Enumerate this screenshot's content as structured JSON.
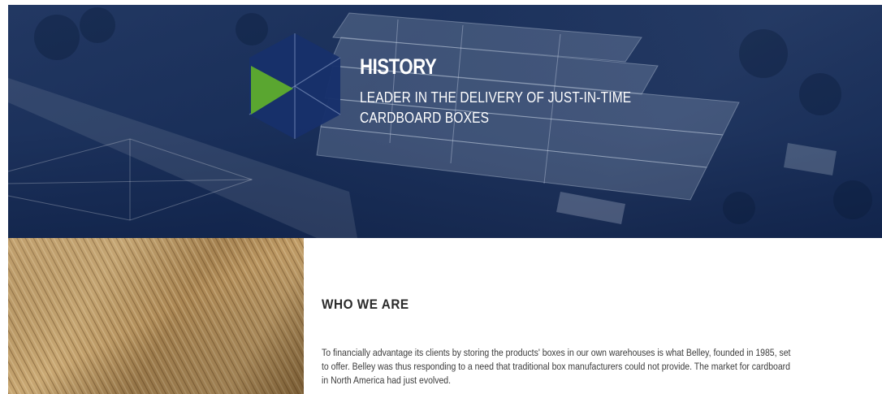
{
  "hero": {
    "title": "HISTORY",
    "subtitle_line1": "LEADER IN THE DELIVERY OF JUST-IN-TIME",
    "subtitle_line2": "CARDBOARD BOXES"
  },
  "colors": {
    "overlay_blue": "#1a3a7a",
    "logo_navy": "#17306b",
    "logo_green": "#5aa630"
  },
  "about": {
    "heading": "WHO WE ARE",
    "lines": [
      "To financially advantage its clients by storing the products' boxes in our own warehouses is what Belley, founded in 1985, set",
      "to offer. Belley was thus responding to a need that traditional box manufacturers could not provide. The market for cardboard",
      "in North America had just evolved."
    ]
  }
}
